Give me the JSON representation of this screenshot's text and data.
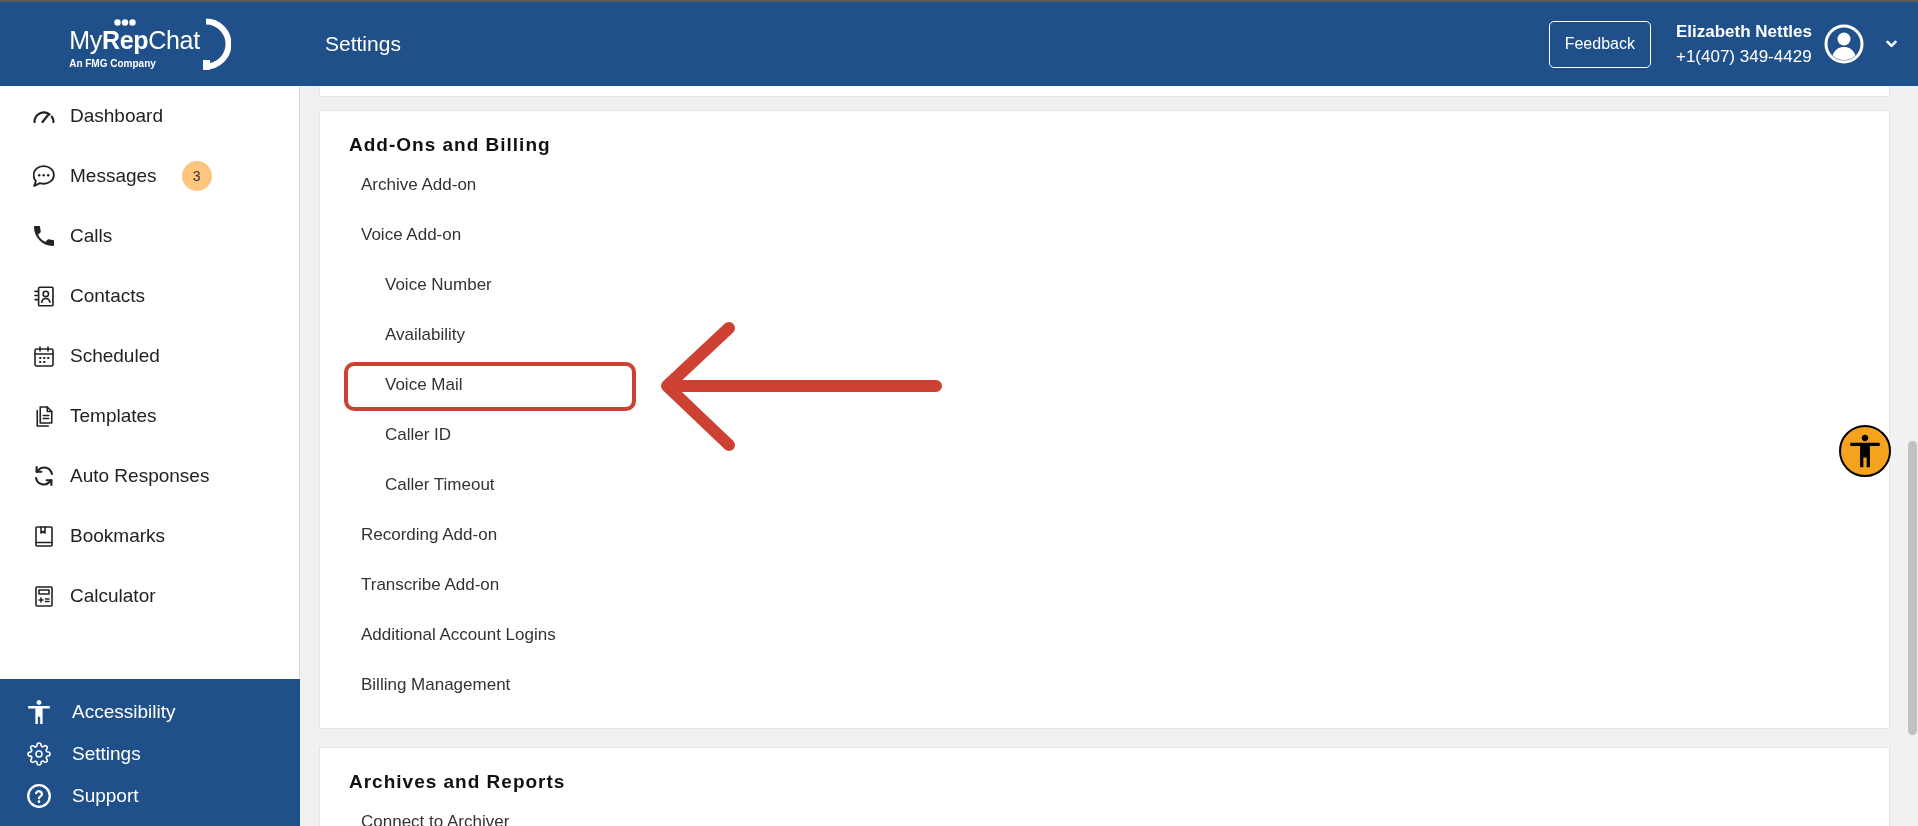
{
  "sidebar": {
    "logo": {
      "wordmark": "My**Rep**Chat",
      "tagline": "An FMG Company"
    },
    "nav_items": [
      {
        "label": "Dashboard"
      },
      {
        "label": "Messages",
        "badge": "3"
      },
      {
        "label": "Calls"
      },
      {
        "label": "Contacts"
      },
      {
        "label": "Scheduled"
      },
      {
        "label": "Templates"
      },
      {
        "label": "Auto Responses"
      },
      {
        "label": "Bookmarks"
      },
      {
        "label": "Calculator"
      }
    ],
    "footer_items": [
      {
        "label": "Accessibility"
      },
      {
        "label": "Settings"
      },
      {
        "label": "Support"
      }
    ]
  },
  "header": {
    "title": "Settings",
    "feedback_button": "Feedback",
    "user": {
      "name": "Elizabeth Nettles",
      "phone": "+1(407) 349-4429"
    }
  },
  "sections": [
    {
      "title": "Add-Ons and Billing",
      "items": [
        {
          "label": "Archive Add-on",
          "highlighted": false
        },
        {
          "label": "Voice Add-on",
          "highlighted": false,
          "children": [
            {
              "label": "Voice Number",
              "highlighted": false
            },
            {
              "label": "Availability",
              "highlighted": false
            },
            {
              "label": "Voice Mail",
              "highlighted": true
            },
            {
              "label": "Caller ID",
              "highlighted": false
            },
            {
              "label": "Caller Timeout",
              "highlighted": false
            }
          ]
        },
        {
          "label": "Recording Add-on",
          "highlighted": false
        },
        {
          "label": "Transcribe Add-on",
          "highlighted": false
        },
        {
          "label": "Additional Account Logins",
          "highlighted": false
        },
        {
          "label": "Billing Management",
          "highlighted": false
        }
      ]
    },
    {
      "title": "Archives and Reports",
      "items": [
        {
          "label": "Connect to Archiver",
          "highlighted": false
        }
      ]
    }
  ]
}
